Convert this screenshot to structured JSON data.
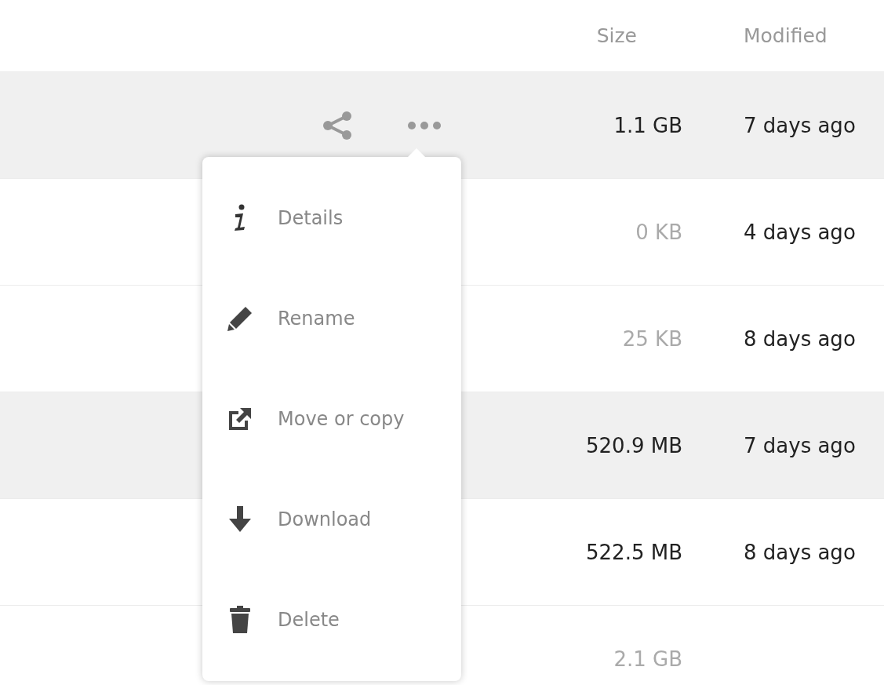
{
  "columns": [
    "Size",
    "Modified"
  ],
  "rows": [
    {
      "size": "1.1 GB",
      "size_dimmed": false,
      "modified": "7 days ago",
      "highlighted": true,
      "show_actions": true
    },
    {
      "size": "0 KB",
      "size_dimmed": true,
      "modified": "4 days ago",
      "highlighted": false
    },
    {
      "size": "25 KB",
      "size_dimmed": true,
      "modified": "8 days ago",
      "highlighted": false
    },
    {
      "size": "520.9 MB",
      "size_dimmed": false,
      "modified": "7 days ago",
      "highlighted": true
    },
    {
      "size": "522.5 MB",
      "size_dimmed": false,
      "modified": "8 days ago",
      "highlighted": false
    },
    {
      "size": "2.1 GB",
      "size_dimmed": true,
      "highlighted": false
    }
  ],
  "menu": {
    "items": [
      {
        "label": "Details"
      },
      {
        "label": "Rename"
      },
      {
        "label": "Move or copy"
      },
      {
        "label": "Download"
      },
      {
        "label": "Delete"
      }
    ]
  }
}
